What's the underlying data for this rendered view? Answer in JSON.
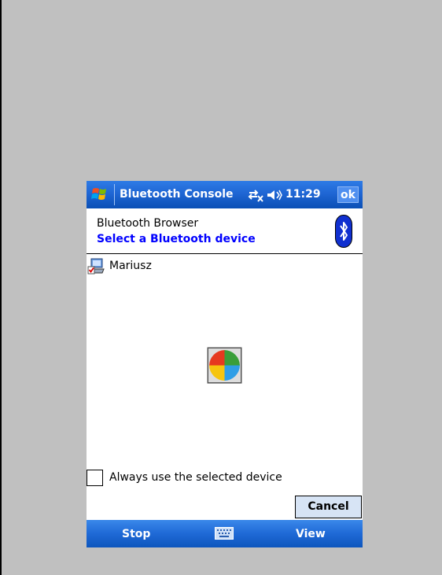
{
  "titlebar": {
    "title": "Bluetooth Console",
    "time": "11:29",
    "ok_label": "ok"
  },
  "header": {
    "title": "Bluetooth Browser",
    "subtitle": "Select a Bluetooth device"
  },
  "device_list": [
    {
      "label": "Mariusz",
      "icon": "computer-icon"
    }
  ],
  "options": {
    "always_use_label": "Always use the selected device",
    "always_use_checked": false
  },
  "buttons": {
    "cancel_label": "Cancel"
  },
  "menubar": {
    "left_label": "Stop",
    "right_label": "View"
  },
  "colors": {
    "titlebar": "#1f66d4",
    "subtitle": "#0000ff",
    "background": "#c0c0c0"
  }
}
